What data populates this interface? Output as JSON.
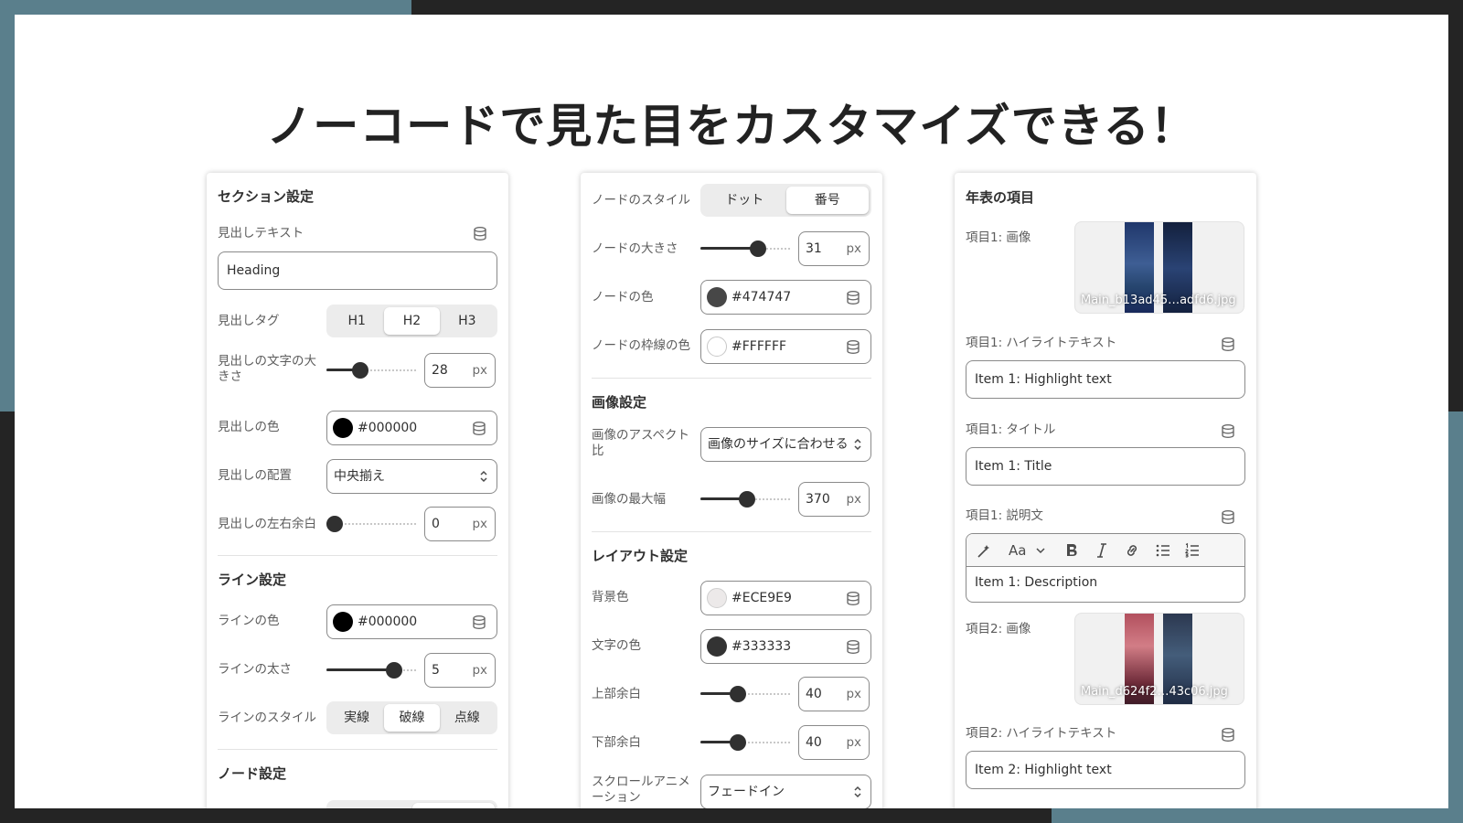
{
  "headline": "ノーコードで見た目をカスタマイズできる！",
  "colors": {
    "background_dark": "#242424",
    "background_accent": "#5a7f8c",
    "slide": "#ffffff",
    "control_dark": "#303030"
  },
  "left_panel": {
    "section_title": "セクション設定",
    "heading_text": {
      "label": "見出しテキスト",
      "value": "Heading"
    },
    "heading_tag": {
      "label": "見出しタグ",
      "options": [
        "H1",
        "H2",
        "H3"
      ],
      "selected": "H2"
    },
    "heading_size": {
      "label": "見出しの文字の大きさ",
      "value": "28",
      "unit": "px",
      "level": 0.38
    },
    "heading_color": {
      "label": "見出しの色",
      "value": "#000000"
    },
    "heading_align": {
      "label": "見出しの配置",
      "value": "中央揃え"
    },
    "heading_padding": {
      "label": "見出しの左右余白",
      "value": "0",
      "unit": "px",
      "level": 0.0
    },
    "line_section_title": "ライン設定",
    "line_color": {
      "label": "ラインの色",
      "value": "#000000"
    },
    "line_width": {
      "label": "ラインの太さ",
      "value": "5",
      "unit": "px",
      "level": 0.75
    },
    "line_style": {
      "label": "ラインのスタイル",
      "options": [
        "実線",
        "破線",
        "点線"
      ],
      "selected": "破線"
    },
    "node_section_title": "ノード設定"
  },
  "middle_panel": {
    "node_style": {
      "label": "ノードのスタイル",
      "options": [
        "ドット",
        "番号"
      ],
      "selected": "番号"
    },
    "node_size": {
      "label": "ノードの大きさ",
      "value": "31",
      "unit": "px",
      "level": 0.64
    },
    "node_color": {
      "label": "ノードの色",
      "value": "#474747"
    },
    "node_border_color": {
      "label": "ノードの枠線の色",
      "value": "#FFFFFF"
    },
    "image_section_title": "画像設定",
    "image_aspect": {
      "label": "画像のアスペクト比",
      "value": "画像のサイズに合わせる"
    },
    "image_max_width": {
      "label": "画像の最大幅",
      "value": "370",
      "unit": "px",
      "level": 0.52
    },
    "layout_section_title": "レイアウト設定",
    "bg_color": {
      "label": "背景色",
      "value": "#ECE9E9"
    },
    "text_color": {
      "label": "文字の色",
      "value": "#333333"
    },
    "top_padding": {
      "label": "上部余白",
      "value": "40",
      "unit": "px",
      "level": 0.42
    },
    "bottom_padding": {
      "label": "下部余白",
      "value": "40",
      "unit": "px",
      "level": 0.42
    },
    "scroll_anim": {
      "label": "スクロールアニメーション",
      "value": "フェードイン"
    }
  },
  "right_panel": {
    "section_title": "年表の項目",
    "item1_image": {
      "label": "項目1: 画像",
      "filename": "Main_b13ad45…adfd6.jpg"
    },
    "item1_highlight": {
      "label": "項目1: ハイライトテキスト",
      "value": "Item 1: Highlight text"
    },
    "item1_title": {
      "label": "項目1: タイトル",
      "value": "Item 1: Title"
    },
    "item1_desc": {
      "label": "項目1: 説明文",
      "value": "Item 1: Description",
      "font_button": "Aa"
    },
    "item2_image": {
      "label": "項目2: 画像",
      "filename": "Main_d624f2…43c06.jpg"
    },
    "item2_highlight": {
      "label": "項目2: ハイライトテキスト",
      "value": "Item 2: Highlight text"
    }
  }
}
